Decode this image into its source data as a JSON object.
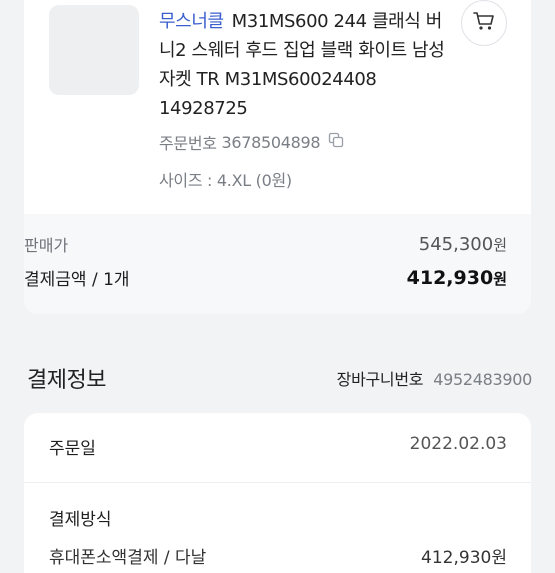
{
  "product": {
    "brand": "무스너클",
    "name": "M31MS600 244 클래식 버니2 스웨터 후드 집업 블랙 화이트 남성 자켓 TR M31MS60024408 14928725",
    "order_number_label": "주문번호",
    "order_number": "3678504898",
    "option_text": "사이즈 : 4.XL (0원)",
    "cart_icon": "cart-icon",
    "copy_icon": "copy-icon"
  },
  "price": {
    "sale_label": "판매가",
    "sale_amount": "545,300",
    "currency": "원",
    "payment_label": "결제금액 / 1개",
    "payment_amount": "412,930"
  },
  "payment_info": {
    "section_title": "결제정보",
    "cart_no_label": "장바구니번호",
    "cart_no": "4952483900",
    "order_date_label": "주문일",
    "order_date": "2022.02.03",
    "method_label": "결제방식",
    "method_partial": "휴대폰소액결제 / 다날",
    "method_amount_partial": "412,930원"
  },
  "colors": {
    "brand_accent": "#3a5fcf",
    "background": "#f2f3f5"
  }
}
